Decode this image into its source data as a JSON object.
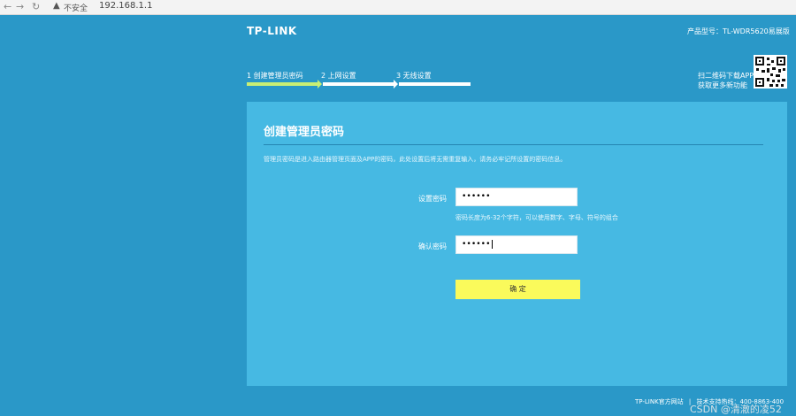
{
  "browser": {
    "back": "←",
    "forward": "→",
    "reload": "↻",
    "security_icon": "warning-icon",
    "security_text": "不安全",
    "url": "192.168.1.1"
  },
  "header": {
    "logo": "TP-LINK",
    "model": "产品型号：TL-WDR5620易展版"
  },
  "steps": [
    {
      "label": "1 创建管理员密码",
      "active": true
    },
    {
      "label": "2 上网设置",
      "active": false
    },
    {
      "label": "3 无线设置",
      "active": false
    }
  ],
  "app_download": {
    "line1": "扫二维码下载APP",
    "line2": "获取更多新功能"
  },
  "panel": {
    "title": "创建管理员密码",
    "description": "管理员密码是进入路由器管理页面及APP的密码，此处设置后将无需重复输入，请务必牢记所设置的密码信息。",
    "password_label": "设置密码",
    "password_value": "••••••",
    "hint": "密码长度为6-32个字符，可以使用数字、字母、符号的组合",
    "confirm_label": "确认密码",
    "confirm_value": "••••••",
    "submit_label": "确 定"
  },
  "footer": {
    "official_site": "TP-LINK官方网站",
    "separator": "|",
    "support": "技术支持热线：400-8863-400"
  },
  "watermark": "CSDN @清澈的凌52",
  "colors": {
    "background": "#2a98c8",
    "panel": "#46b9e3",
    "active_step": "#c9ef74",
    "button": "#fafa5b"
  }
}
